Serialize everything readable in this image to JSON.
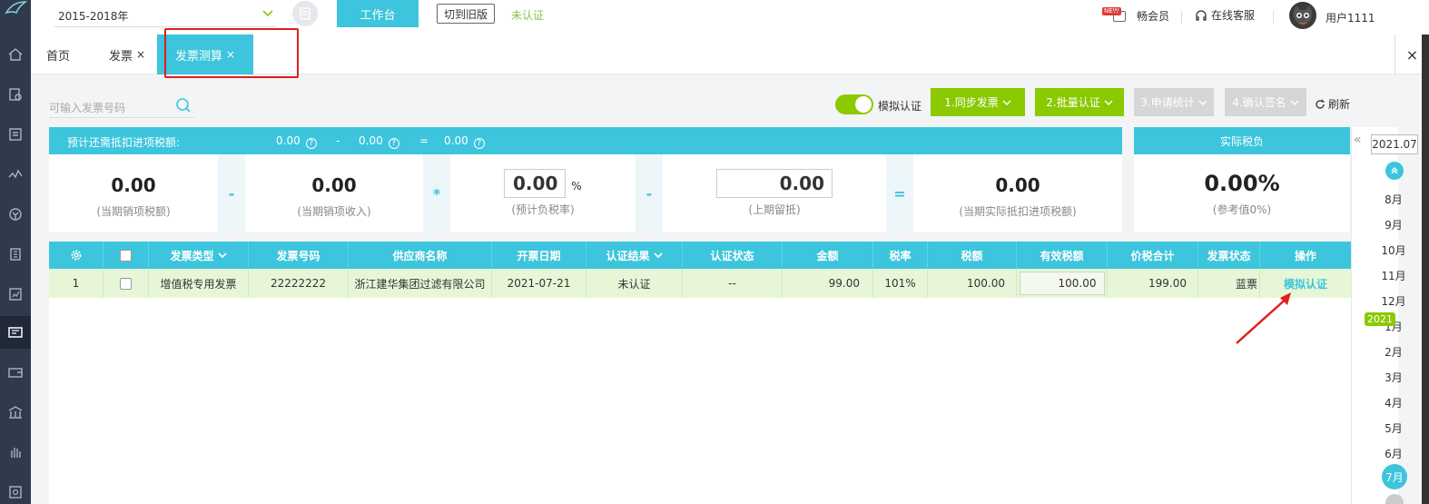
{
  "topbar": {
    "year_range": "2015-2018年",
    "workbench_button": "工作台",
    "switch_old_button": "切到旧版",
    "cert_status": "未认证",
    "new_badge": "NEW",
    "vip_label": "畅会员",
    "service_label": "在线客服",
    "username": "用户1111"
  },
  "tabs": [
    {
      "label": "首页"
    },
    {
      "label": "发票",
      "close": "×"
    },
    {
      "label": "发票测算",
      "close": "×"
    }
  ],
  "tab_close_all": "×",
  "search": {
    "placeholder": "可输入发票号码"
  },
  "actions": {
    "toggle_label": "模拟认证",
    "sync": "1.同步发票",
    "batch": "2.批量认证",
    "stats": "3.申请统计",
    "confirm": "4.确认签名",
    "refresh": "刷新"
  },
  "calc": {
    "header_label": "预计还需抵扣进项税额:",
    "header_v1": "0.00",
    "header_minus": "-",
    "header_v2": "0.00",
    "header_eq": "=",
    "header_v3": "0.00",
    "help_glyph": "?",
    "items": [
      {
        "value": "0.00",
        "label": "(当期销项税额)"
      },
      {
        "value": "0.00",
        "label": "(当期销项收入)"
      },
      {
        "value": "0.00",
        "unit": "%",
        "label": "(预计负税率)"
      },
      {
        "value": "0.00",
        "label": "(上期留抵)"
      },
      {
        "value": "0.00",
        "label": "(当期实际抵扣进项税额)"
      }
    ],
    "ops": [
      "-",
      "*",
      "-",
      "="
    ]
  },
  "real_tax": {
    "header": "实际税负",
    "value": "0.00%",
    "label": "(参考值0%)"
  },
  "table": {
    "columns": [
      "发票类型",
      "发票号码",
      "供应商名称",
      "开票日期",
      "认证结果",
      "认证状态",
      "金额",
      "税率",
      "税额",
      "有效税额",
      "价税合计",
      "发票状态",
      "操作"
    ],
    "rows": [
      {
        "index": "1",
        "type": "增值税专用发票",
        "number": "22222222",
        "supplier": "浙江建华集团过滤有限公司",
        "date": "2021-07-21",
        "result": "未认证",
        "status": "--",
        "amount": "99.00",
        "rate": "101%",
        "tax": "100.00",
        "effective_tax": "100.00",
        "total": "199.00",
        "invoice_status": "蓝票",
        "action": "模拟认证"
      }
    ]
  },
  "timeline": {
    "collapse": "«",
    "current": "2021.07",
    "year_badge": "2021",
    "months_prev": [
      "8月",
      "9月",
      "10月",
      "11月",
      "12月",
      "1月",
      "2月",
      "3月",
      "4月",
      "5月",
      "6月"
    ],
    "selected": "7月"
  }
}
